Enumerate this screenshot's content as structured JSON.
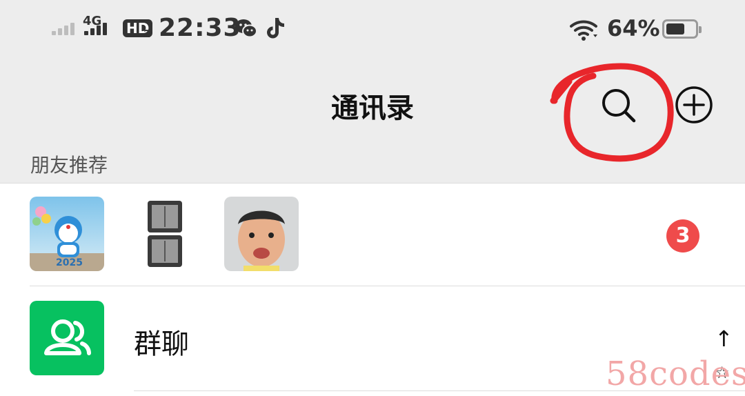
{
  "status_bar": {
    "network": "4G",
    "hd_label": "HD",
    "hd_sub": "2",
    "time": "22:33",
    "battery_percent": "64%",
    "battery_level": 0.64,
    "icons": [
      "signal-icon",
      "wechat-icon",
      "tiktok-icon",
      "wifi-icon",
      "battery-icon"
    ]
  },
  "header": {
    "title": "通讯录",
    "search_icon": "search-icon",
    "add_icon": "plus-circle-icon",
    "annotation_color": "#e8262b"
  },
  "friend_recommend": {
    "section_label": "朋友推荐",
    "badge_count": "3",
    "avatars": [
      {
        "name": "doraemon-avatar",
        "caption": "2025"
      },
      {
        "name": "device-avatar"
      },
      {
        "name": "child-photo-avatar"
      }
    ]
  },
  "rows": [
    {
      "label": "群聊",
      "icon": "group-chat-icon",
      "color": "#07c160"
    }
  ],
  "index_bar": {
    "items": [
      "↑",
      "☆"
    ]
  },
  "watermark": "58codes"
}
